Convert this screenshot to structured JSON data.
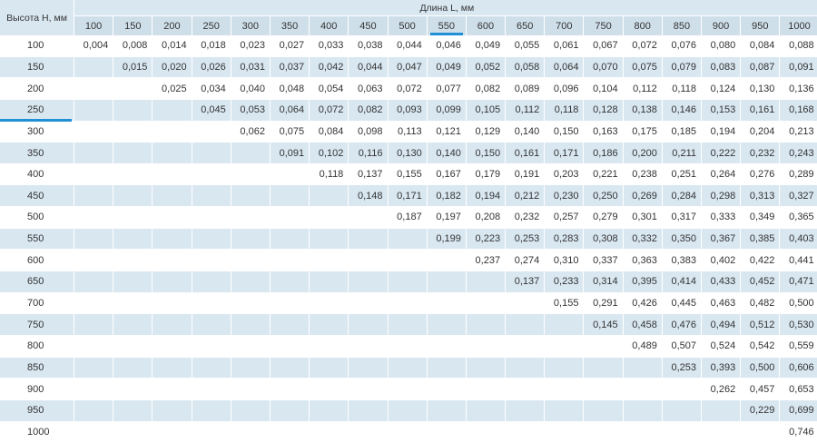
{
  "table": {
    "row_header_label": "Высота H, мм",
    "column_group_label": "Длина L, мм",
    "active_column": "550",
    "active_row": "250",
    "colors": {
      "alt_row": "#d9e7f1",
      "header": "#cfdfea",
      "accent": "#1f8fd6"
    },
    "columns": [
      "100",
      "150",
      "200",
      "250",
      "300",
      "350",
      "400",
      "450",
      "500",
      "550",
      "600",
      "650",
      "700",
      "750",
      "800",
      "850",
      "900",
      "950",
      "1000"
    ],
    "rows": [
      {
        "h": "100",
        "cells": [
          "0,004",
          "0,008",
          "0,014",
          "0,018",
          "0,023",
          "0,027",
          "0,033",
          "0,038",
          "0,044",
          "0,046",
          "0,049",
          "0,055",
          "0,061",
          "0,067",
          "0,072",
          "0,076",
          "0,080",
          "0,084",
          "0,088"
        ]
      },
      {
        "h": "150",
        "cells": [
          "",
          "0,015",
          "0,020",
          "0,026",
          "0,031",
          "0,037",
          "0,042",
          "0,044",
          "0,047",
          "0,049",
          "0,052",
          "0,058",
          "0,064",
          "0,070",
          "0,075",
          "0,079",
          "0,083",
          "0,087",
          "0,091"
        ]
      },
      {
        "h": "200",
        "cells": [
          "",
          "",
          "0,025",
          "0,034",
          "0,040",
          "0,048",
          "0,054",
          "0,063",
          "0,072",
          "0,077",
          "0,082",
          "0,089",
          "0,096",
          "0,104",
          "0,112",
          "0,118",
          "0,124",
          "0,130",
          "0,136"
        ]
      },
      {
        "h": "250",
        "cells": [
          "",
          "",
          "",
          "0,045",
          "0,053",
          "0,064",
          "0,072",
          "0,082",
          "0,093",
          "0,099",
          "0,105",
          "0,112",
          "0,118",
          "0,128",
          "0,138",
          "0,146",
          "0,153",
          "0,161",
          "0,168"
        ]
      },
      {
        "h": "300",
        "cells": [
          "",
          "",
          "",
          "",
          "0,062",
          "0,075",
          "0,084",
          "0,098",
          "0,113",
          "0,121",
          "0,129",
          "0,140",
          "0,150",
          "0,163",
          "0,175",
          "0,185",
          "0,194",
          "0,204",
          "0,213"
        ]
      },
      {
        "h": "350",
        "cells": [
          "",
          "",
          "",
          "",
          "",
          "0,091",
          "0,102",
          "0,116",
          "0,130",
          "0,140",
          "0,150",
          "0,161",
          "0,171",
          "0,186",
          "0,200",
          "0,211",
          "0,222",
          "0,232",
          "0,243"
        ]
      },
      {
        "h": "400",
        "cells": [
          "",
          "",
          "",
          "",
          "",
          "",
          "0,118",
          "0,137",
          "0,155",
          "0,167",
          "0,179",
          "0,191",
          "0,203",
          "0,221",
          "0,238",
          "0,251",
          "0,264",
          "0,276",
          "0,289"
        ]
      },
      {
        "h": "450",
        "cells": [
          "",
          "",
          "",
          "",
          "",
          "",
          "",
          "0,148",
          "0,171",
          "0,182",
          "0,194",
          "0,212",
          "0,230",
          "0,250",
          "0,269",
          "0,284",
          "0,298",
          "0,313",
          "0,327"
        ]
      },
      {
        "h": "500",
        "cells": [
          "",
          "",
          "",
          "",
          "",
          "",
          "",
          "",
          "0,187",
          "0,197",
          "0,208",
          "0,232",
          "0,257",
          "0,279",
          "0,301",
          "0,317",
          "0,333",
          "0,349",
          "0,365"
        ]
      },
      {
        "h": "550",
        "cells": [
          "",
          "",
          "",
          "",
          "",
          "",
          "",
          "",
          "",
          "0,199",
          "0,223",
          "0,253",
          "0,283",
          "0,308",
          "0,332",
          "0,350",
          "0,367",
          "0,385",
          "0,403"
        ]
      },
      {
        "h": "600",
        "cells": [
          "",
          "",
          "",
          "",
          "",
          "",
          "",
          "",
          "",
          "",
          "0,237",
          "0,274",
          "0,310",
          "0,337",
          "0,363",
          "0,383",
          "0,402",
          "0,422",
          "0,441"
        ]
      },
      {
        "h": "650",
        "cells": [
          "",
          "",
          "",
          "",
          "",
          "",
          "",
          "",
          "",
          "",
          "",
          "0,137",
          "0,233",
          "0,314",
          "0,395",
          "0,414",
          "0,433",
          "0,452",
          "0,471"
        ]
      },
      {
        "h": "700",
        "cells": [
          "",
          "",
          "",
          "",
          "",
          "",
          "",
          "",
          "",
          "",
          "",
          "",
          "0,155",
          "0,291",
          "0,426",
          "0,445",
          "0,463",
          "0,482",
          "0,500"
        ]
      },
      {
        "h": "750",
        "cells": [
          "",
          "",
          "",
          "",
          "",
          "",
          "",
          "",
          "",
          "",
          "",
          "",
          "",
          "0,145",
          "0,458",
          "0,476",
          "0,494",
          "0,512",
          "0,530"
        ]
      },
      {
        "h": "800",
        "cells": [
          "",
          "",
          "",
          "",
          "",
          "",
          "",
          "",
          "",
          "",
          "",
          "",
          "",
          "",
          "0,489",
          "0,507",
          "0,524",
          "0,542",
          "0,559"
        ]
      },
      {
        "h": "850",
        "cells": [
          "",
          "",
          "",
          "",
          "",
          "",
          "",
          "",
          "",
          "",
          "",
          "",
          "",
          "",
          "",
          "0,253",
          "0,393",
          "0,500",
          "0,606"
        ]
      },
      {
        "h": "900",
        "cells": [
          "",
          "",
          "",
          "",
          "",
          "",
          "",
          "",
          "",
          "",
          "",
          "",
          "",
          "",
          "",
          "",
          "0,262",
          "0,457",
          "0,653"
        ]
      },
      {
        "h": "950",
        "cells": [
          "",
          "",
          "",
          "",
          "",
          "",
          "",
          "",
          "",
          "",
          "",
          "",
          "",
          "",
          "",
          "",
          "",
          "0,229",
          "0,699"
        ]
      },
      {
        "h": "1000",
        "cells": [
          "",
          "",
          "",
          "",
          "",
          "",
          "",
          "",
          "",
          "",
          "",
          "",
          "",
          "",
          "",
          "",
          "",
          "",
          "0,746"
        ]
      }
    ]
  }
}
